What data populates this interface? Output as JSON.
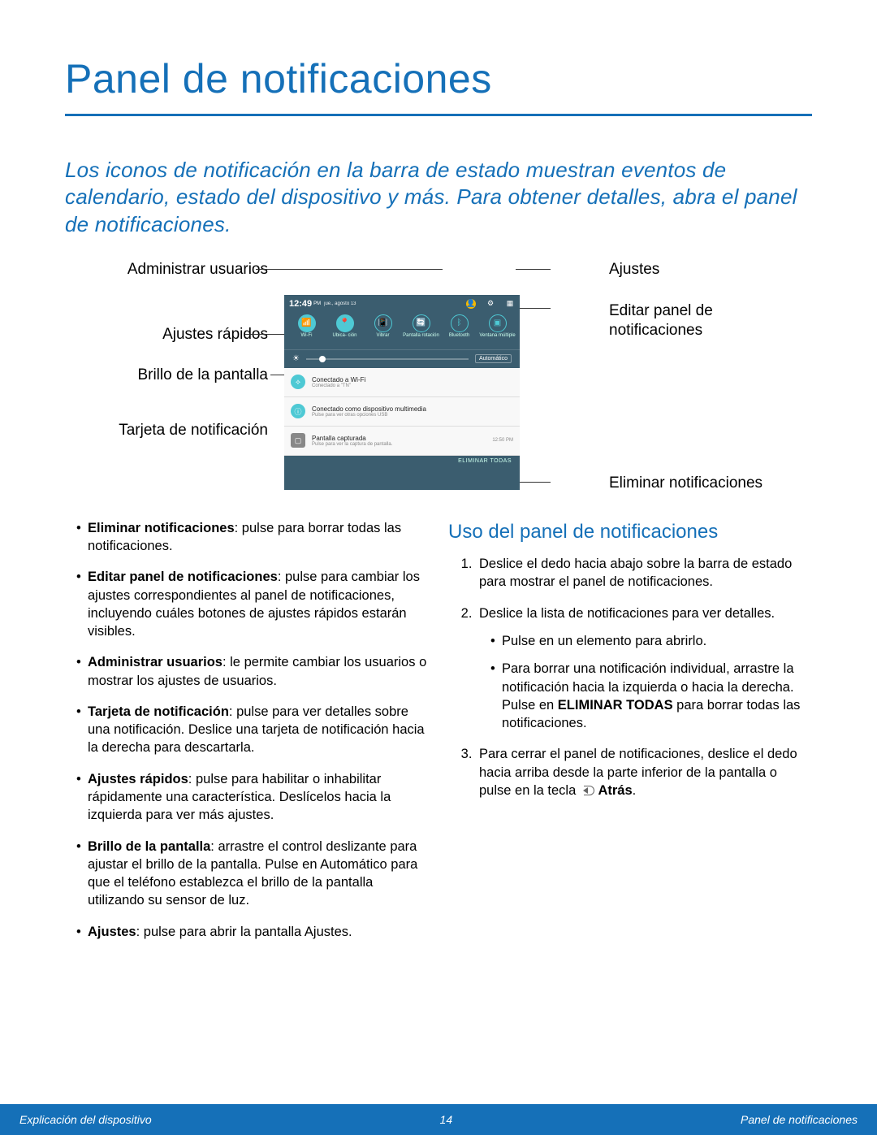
{
  "title": "Panel de notificaciones",
  "intro": "Los iconos de notificación en la barra de estado muestran eventos de calendario, estado del dispositivo y más. Para obtener detalles, abra el panel de notificaciones.",
  "diagram": {
    "left": {
      "l1": "Administrar usuarios",
      "l2": "Ajustes rápidos",
      "l3": "Brillo de la pantalla",
      "l4": "Tarjeta de notificación"
    },
    "right": {
      "r1": "Ajustes",
      "r2a": "Editar panel de",
      "r2b": "notificaciones",
      "r3": "Eliminar notificaciones"
    }
  },
  "screenshot": {
    "time": "12:49",
    "ampm": "PM",
    "date": "jue., agosto 13",
    "quick": [
      {
        "icon": "📶",
        "label": "Wi-Fi"
      },
      {
        "icon": "📍",
        "label": "Ubica-\nción"
      },
      {
        "icon": "📳",
        "label": "Vibrar"
      },
      {
        "icon": "🔄",
        "label": "Pantalla\nrotación"
      },
      {
        "icon": "ᛒ",
        "label": "Bluetooth"
      },
      {
        "icon": "▣",
        "label": "Ventana\nmúltiple"
      }
    ],
    "brightness_auto": "Automático",
    "notifications": [
      {
        "icon": "⟡",
        "title": "Conectado a Wi-Fi",
        "sub": "Conectado a \"TN\"",
        "time": ""
      },
      {
        "icon": "ⓘ",
        "title": "Conectado como dispositivo multimedia",
        "sub": "Pulse para ver otras opciones USB",
        "time": ""
      },
      {
        "icon": "▢",
        "title": "Pantalla capturada",
        "sub": "Pulse para ver la captura de pantalla.",
        "time": "12:50 PM"
      }
    ],
    "clear_all": "ELIMINAR TODAS"
  },
  "bullets": [
    {
      "term": "Eliminar notificaciones",
      "text": ": pulse para borrar todas las notificaciones."
    },
    {
      "term": "Editar panel de notificaciones",
      "text": ": pulse para cambiar los ajustes correspondientes al panel de notificaciones, incluyendo cuáles botones de ajustes rápidos estarán visibles."
    },
    {
      "term": "Administrar usuarios",
      "text": ": le permite cambiar los usuarios o mostrar los ajustes de usuarios."
    },
    {
      "term": "Tarjeta de notificación",
      "text": ": pulse para ver detalles sobre una notificación. Deslice una tarjeta de notificación hacia la derecha para descartarla."
    },
    {
      "term": "Ajustes rápidos",
      "text": ": pulse para habilitar o inhabilitar rápidamente una característica. Deslícelos hacia la izquierda para ver más ajustes."
    },
    {
      "term": "Brillo de la pantalla",
      "text": ": arrastre el control deslizante para ajustar el brillo de la pantalla. Pulse en Automático para que el teléfono establezca el brillo de la pantalla utilizando su sensor de luz."
    },
    {
      "term": "Ajustes",
      "text": ": pulse para abrir la pantalla Ajustes."
    }
  ],
  "usage": {
    "heading": "Uso del panel de notificaciones",
    "steps": [
      "Deslice el dedo hacia abajo sobre la barra de estado para mostrar el panel de notificaciones.",
      "Deslice la lista de notificaciones para ver detalles.",
      "Para cerrar el panel de notificaciones, deslice el dedo hacia arriba desde la parte inferior de la pantalla o pulse en la tecla "
    ],
    "step2_sub": [
      "Pulse en un elemento para abrirlo.",
      "Para borrar una notificación individual, arrastre la notificación hacia la izquierda o hacia la derecha. Pulse en ELIMINAR TODAS para borrar todas las notificaciones."
    ],
    "step3_sub_pre": "Para borrar una notificación individual, arrastre la notificación hacia la izquierda o hacia la derecha. Pulse en ",
    "step3_bold": "ELIMINAR TODAS",
    "step3_post": " para borrar todas las notificaciones.",
    "back_label": "Atrás"
  },
  "footer": {
    "left": "Explicación del dispositivo",
    "center": "14",
    "right": "Panel de notificaciones"
  }
}
